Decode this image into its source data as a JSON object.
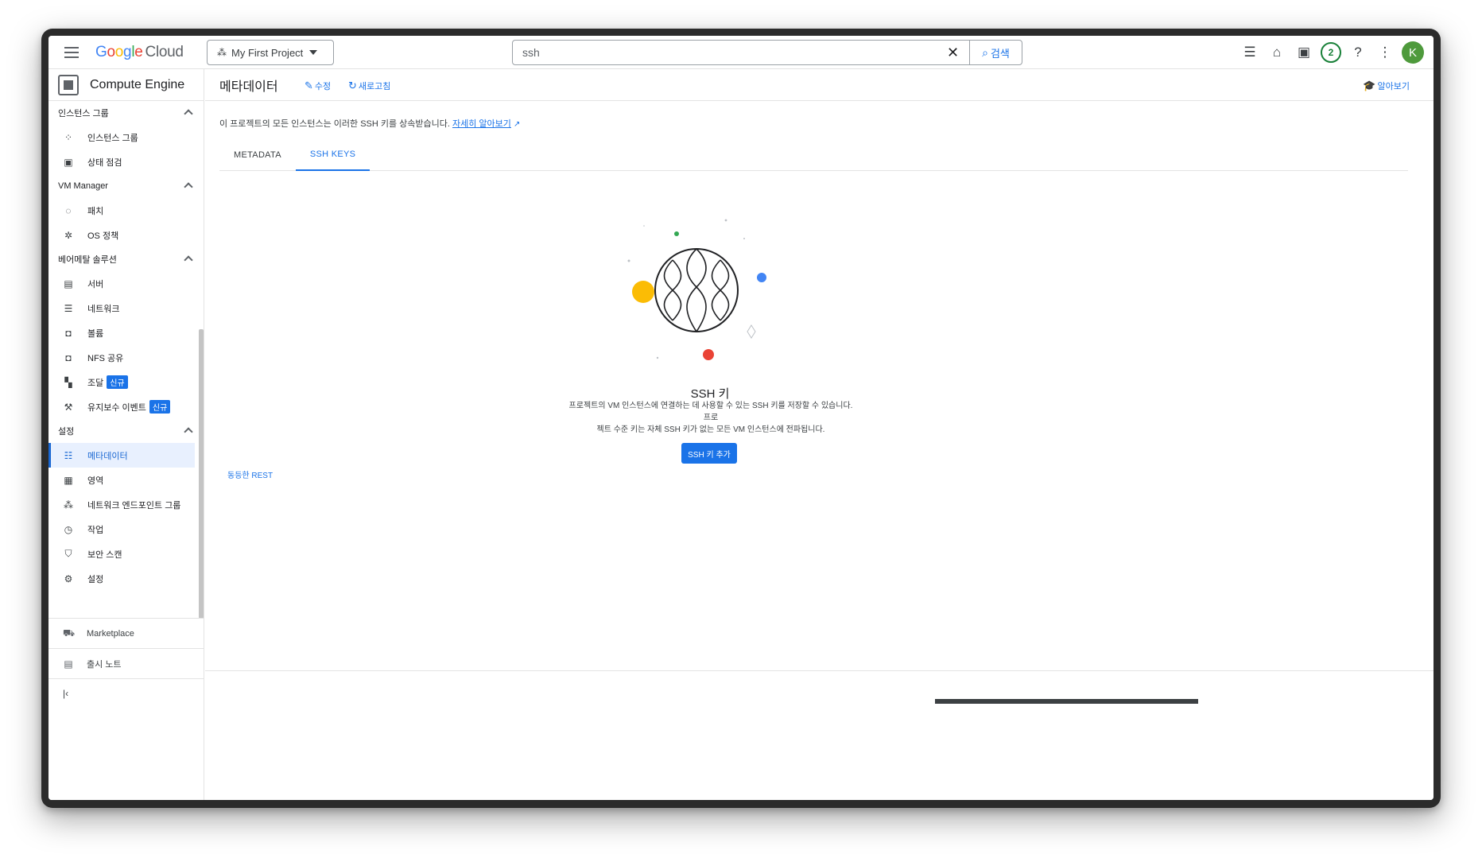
{
  "topbar": {
    "brand_google": [
      "G",
      "o",
      "o",
      "g",
      "l",
      "e"
    ],
    "brand_cloud": "Cloud",
    "project_name": "My First Project",
    "search_value": "ssh",
    "search_button": "검색",
    "notification_count": "2",
    "avatar_initial": "K"
  },
  "sidebar": {
    "product": "Compute Engine",
    "sections": [
      {
        "label": "인스턴스 그룹",
        "items": [
          {
            "label": "인스턴스 그룹",
            "icon": "instance-group-icon"
          },
          {
            "label": "상태 점검",
            "icon": "health-check-icon"
          }
        ]
      },
      {
        "label": "VM Manager",
        "items": [
          {
            "label": "패치",
            "icon": "patch-icon"
          },
          {
            "label": "OS 정책",
            "icon": "os-policy-icon"
          }
        ]
      },
      {
        "label": "베어메탈 솔루션",
        "items": [
          {
            "label": "서버",
            "icon": "server-icon"
          },
          {
            "label": "네트워크",
            "icon": "network-icon"
          },
          {
            "label": "볼륨",
            "icon": "volume-icon"
          },
          {
            "label": "NFS 공유",
            "icon": "nfs-share-icon"
          },
          {
            "label": "조달",
            "icon": "procurement-icon",
            "badge": "신규"
          },
          {
            "label": "유지보수 이벤트",
            "icon": "wrench-icon",
            "badge": "신규"
          }
        ]
      },
      {
        "label": "설정",
        "items": [
          {
            "label": "메타데이터",
            "icon": "metadata-icon",
            "active": true
          },
          {
            "label": "영역",
            "icon": "zones-icon"
          },
          {
            "label": "네트워크 엔드포인트 그룹",
            "icon": "endpoint-group-icon"
          },
          {
            "label": "작업",
            "icon": "clock-icon"
          },
          {
            "label": "보안 스캔",
            "icon": "shield-icon"
          },
          {
            "label": "설정",
            "icon": "gear-icon"
          }
        ]
      }
    ],
    "marketplace": "Marketplace",
    "release_notes": "출시 노트"
  },
  "content": {
    "title": "메타데이터",
    "edit_label": "수정",
    "refresh_label": "새로고침",
    "learn_label": "알아보기",
    "info_text": "이 프로젝트의 모든 인스턴스는 이러한 SSH 키를 상속받습니다. ",
    "info_link": "자세히 알아보기",
    "tabs": [
      "METADATA",
      "SSH KEYS"
    ],
    "active_tab": "SSH KEYS",
    "empty_title": "SSH 키",
    "empty_desc_1": "프로젝트의 VM 인스턴스에 연결하는 데 사용할 수 있는 SSH 키를 저장할 수 있습니다. 프로",
    "empty_desc_2": "젝트 수준 키는 자체 SSH 키가 없는 모든 VM 인스턴스에 전파됩니다.",
    "add_button": "SSH 키 추가",
    "rest_link": "동등한 REST"
  },
  "colors": {
    "accent": "#1a73e8",
    "active_bg": "#e8f0fe",
    "badge_green": "#188038",
    "avatar": "#4e9a3c"
  }
}
